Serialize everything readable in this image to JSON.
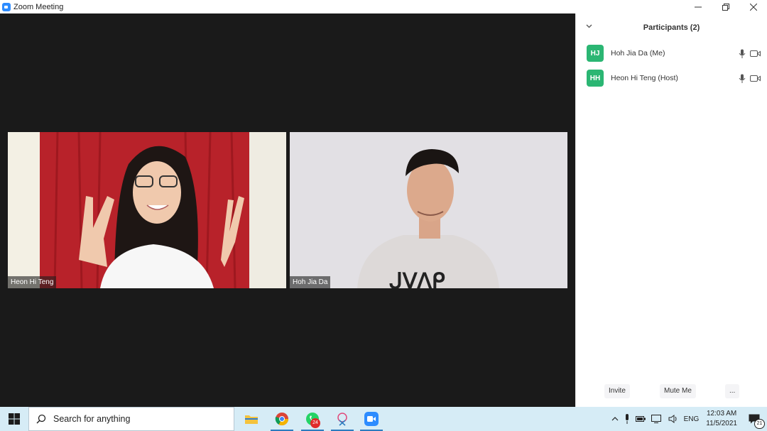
{
  "window": {
    "title": "Zoom Meeting"
  },
  "videos": [
    {
      "name": "Heon Hi Teng"
    },
    {
      "name": "Hoh Jia Da"
    }
  ],
  "participants_panel": {
    "title": "Participants (2)",
    "participants": [
      {
        "initials": "HJ",
        "name": "Hoh Jia Da (Me)",
        "avatar_color": "#2bb673"
      },
      {
        "initials": "HH",
        "name": "Heon Hi Teng (Host)",
        "avatar_color": "#2bb673"
      }
    ],
    "buttons": {
      "invite": "Invite",
      "mute_me": "Mute Me",
      "more": "..."
    }
  },
  "taskbar": {
    "search_placeholder": "Search for anything",
    "whatsapp_badge": "24",
    "language": "ENG",
    "time": "12:03 AM",
    "date": "11/5/2021",
    "notifications_count": "21"
  },
  "colors": {
    "accent": "#2d8cff",
    "avatar": "#2bb673",
    "video_bg": "#1a1a1a",
    "taskbar": "#d6ecf6"
  }
}
